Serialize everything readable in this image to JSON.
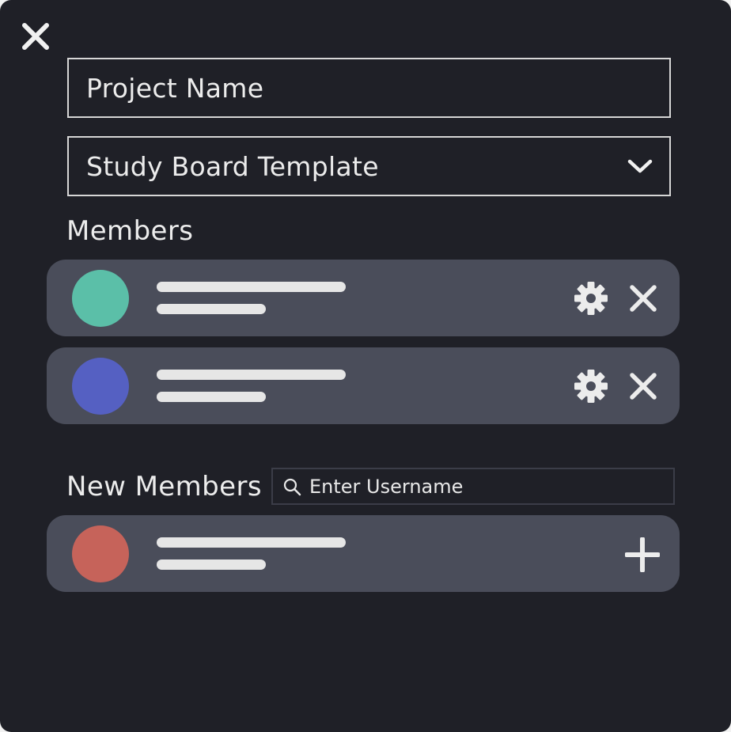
{
  "form": {
    "project_name_placeholder": "Project Name",
    "template_value": "Study Board Template"
  },
  "members": {
    "title": "Members",
    "items": [
      {
        "avatar_color": "#5bbfa8"
      },
      {
        "avatar_color": "#5560c2"
      }
    ]
  },
  "new_members": {
    "title": "New Members",
    "search_placeholder": "Enter Username",
    "items": [
      {
        "avatar_color": "#c6635a"
      }
    ]
  },
  "icons": {
    "close": "close-icon",
    "dropdown": "chevron-down-icon",
    "settings": "gear-icon",
    "remove": "close-icon",
    "add": "plus-icon",
    "search": "search-icon"
  },
  "colors": {
    "background": "#1f2027",
    "card": "#4a4d5a",
    "text": "#ececec"
  }
}
